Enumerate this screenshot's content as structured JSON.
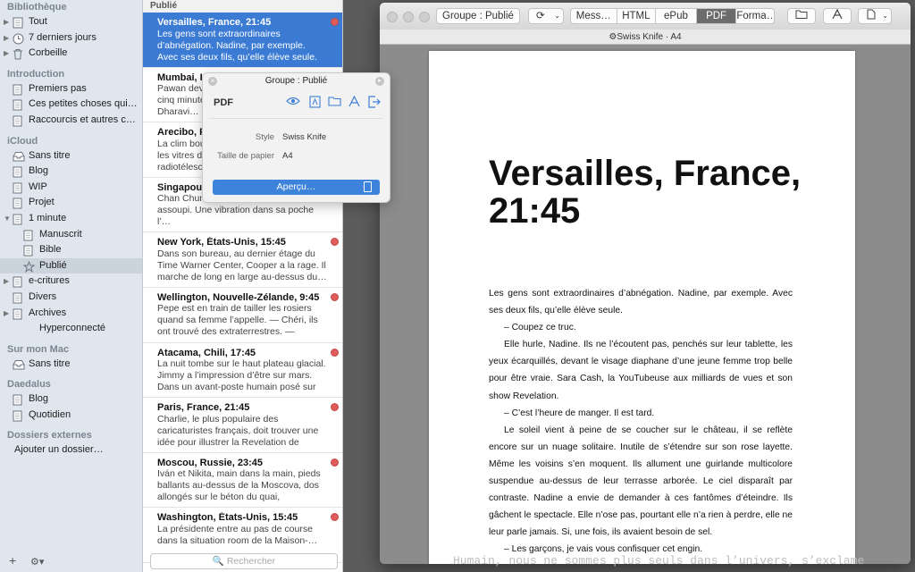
{
  "sidebar": {
    "sections": [
      {
        "title": "Bibliothèque",
        "items": [
          {
            "label": "Tout",
            "icon": "library-icon",
            "arrow": true,
            "indent": 0
          },
          {
            "label": "7 derniers jours",
            "icon": "clock-icon",
            "arrow": true,
            "indent": 0
          },
          {
            "label": "Corbeille",
            "icon": "trash-icon",
            "arrow": true,
            "indent": 0
          }
        ]
      },
      {
        "title": "Introduction",
        "items": [
          {
            "label": "Premiers pas",
            "icon": "document-icon",
            "arrow": false,
            "indent": 0
          },
          {
            "label": "Ces petites choses qui fo…",
            "icon": "document-icon",
            "arrow": false,
            "indent": 0
          },
          {
            "label": "Raccourcis et autres con…",
            "icon": "document-icon",
            "arrow": false,
            "indent": 0
          }
        ]
      },
      {
        "title": "iCloud",
        "items": [
          {
            "label": "Sans titre",
            "icon": "inbox-icon",
            "arrow": false,
            "indent": 0
          },
          {
            "label": "Blog",
            "icon": "document-icon",
            "arrow": false,
            "indent": 0
          },
          {
            "label": "WIP",
            "icon": "document-icon",
            "arrow": false,
            "indent": 0
          },
          {
            "label": "Projet",
            "icon": "document-icon",
            "arrow": false,
            "indent": 0
          },
          {
            "label": "1 minute",
            "icon": "document-icon",
            "arrow": true,
            "open": true,
            "indent": 0
          },
          {
            "label": "Manuscrit",
            "icon": "document-icon",
            "arrow": false,
            "indent": 1
          },
          {
            "label": "Bible",
            "icon": "document-icon",
            "arrow": false,
            "indent": 1
          },
          {
            "label": "Publié",
            "icon": "star-icon",
            "arrow": false,
            "indent": 1,
            "selected": true
          },
          {
            "label": "e-critures",
            "icon": "document-icon",
            "arrow": true,
            "indent": 0
          },
          {
            "label": "Divers",
            "icon": "document-icon",
            "arrow": false,
            "indent": 0
          },
          {
            "label": "Archives",
            "icon": "document-icon",
            "arrow": true,
            "indent": 0
          },
          {
            "label": "Hyperconnecté",
            "icon": "",
            "arrow": false,
            "indent": 1
          }
        ]
      },
      {
        "title": "Sur mon Mac",
        "items": [
          {
            "label": "Sans titre",
            "icon": "inbox-icon",
            "arrow": false,
            "indent": 0
          }
        ]
      },
      {
        "title": "Daedalus",
        "items": [
          {
            "label": "Blog",
            "icon": "document-icon",
            "arrow": false,
            "indent": 0
          },
          {
            "label": "Quotidien",
            "icon": "document-icon",
            "arrow": false,
            "indent": 0
          }
        ]
      },
      {
        "title": "Dossiers externes",
        "items": [
          {
            "label": "Ajouter un dossier…",
            "icon": "",
            "arrow": false,
            "indent": 0,
            "plain": true
          }
        ]
      }
    ],
    "add_label": "+",
    "gear_label": "⚙▾"
  },
  "list": {
    "header": "Publié",
    "search_placeholder": "🔍 Rechercher",
    "items": [
      {
        "title": "Versailles, France, 21:45",
        "body": "Les gens sont extraordinaires d’abnégation. Nadine, par exemple. Avec ses deux fils, qu’elle élève seule. — Co…",
        "selected": true
      },
      {
        "title": "Mumbai, Inde, 01:15",
        "body": "Pawan devait rendre son rapport dans cinq minutes, pas une de plus. Le jour, le Dharavi…"
      },
      {
        "title": "Arecibo, Porto Rico, 11:15",
        "body": "La clim bourdonnait doucement, derrière les vitres de la salle de contrôle du radiotélescope…"
      },
      {
        "title": "Singapour, Singapour, 4:45",
        "body": "Chan Chun Chee sursaute. Il s’était assoupi. Une vibration dans sa poche l’…"
      },
      {
        "title": "New York, États-Unis, 15:45",
        "body": "Dans son bureau, au dernier étage du Time Warner Center, Cooper a la rage. Il marche de long en large au-dessus du…"
      },
      {
        "title": "Wellington, Nouvelle-Zélande, 9:45",
        "body": "Pepe est en train de tailler les rosiers quand sa femme l’appelle. — Chéri, ils ont trouvé des extraterrestres. — Invite…"
      },
      {
        "title": "Atacama, Chili, 17:45",
        "body": "La nuit tombe sur le haut plateau glacial. Jimmy a l’impression d’être sur mars. Dans un avant-poste humain posé sur l…"
      },
      {
        "title": "Paris, France, 21:45",
        "body": "Charlie, le plus populaire des caricaturistes français, doit trouver une idée pour illustrer la Revelation de Sara…"
      },
      {
        "title": "Moscou, Russie, 23:45",
        "body": "Iván et Nikita, main dans la main, pieds ballants au-dessus de la Moscova, dos allongés sur le béton du quai, regardent…"
      },
      {
        "title": "Washington, États-Unis, 15:45",
        "body": "La présidente entre au pas de course dans la situation room de la Maison-…"
      }
    ]
  },
  "preview": {
    "group_button": "Groupe : Publié",
    "refresh_icon": "⟳",
    "formats": [
      "Mess…",
      "HTML",
      "ePub",
      "PDF",
      "Forma…"
    ],
    "active_format": "PDF",
    "style_bar": "⚙Swiss Knife · A4",
    "page_title": "Versailles, France, 21:45",
    "paragraphs": [
      "Les gens sont extraordinaires d’abnégation. Nadine, par exemple. Avec ses deux fils, qu’elle élève seule.",
      "– Coupez ce truc.",
      "Elle hurle, Nadine. Ils ne l’écoutent pas, penchés sur leur tablette, les yeux écarquillés, devant le visage diaphane d’une jeune femme trop belle pour être vraie. Sara Cash, la YouTubeuse aux milliards de vues et son show Revelation.",
      "– C’est l’heure de manger. Il est tard.",
      "Le soleil vient à peine de se coucher sur le château, il se reflète encore sur un nuage solitaire. Inutile de s’étendre sur son rose layette. Même les voisins s’en moquent. Ils allument une guirlande multicolore suspendue au-dessus de leur terrasse arborée. Le ciel disparaît par contraste. Nadine a envie de demander à ces fantômes d’éteindre. Ils gâchent le spectacle. Elle n’ose pas, pourtant elle n’a rien à perdre, elle ne leur parle jamais. Si, une fois, ils avaient besoin de sel.",
      "– Les garçons, je vais vous confisquer cet engin."
    ],
    "bleed_text": "Humain, nous ne sommes plus seuls dans l’univers, s’exclame"
  },
  "popover": {
    "title": "Groupe : Publié",
    "format_label": "PDF",
    "style_label": "Style",
    "style_value": "Swiss Knife",
    "paper_label": "Taille de papier",
    "paper_value": "A4",
    "preview_button": "Aperçu…"
  }
}
